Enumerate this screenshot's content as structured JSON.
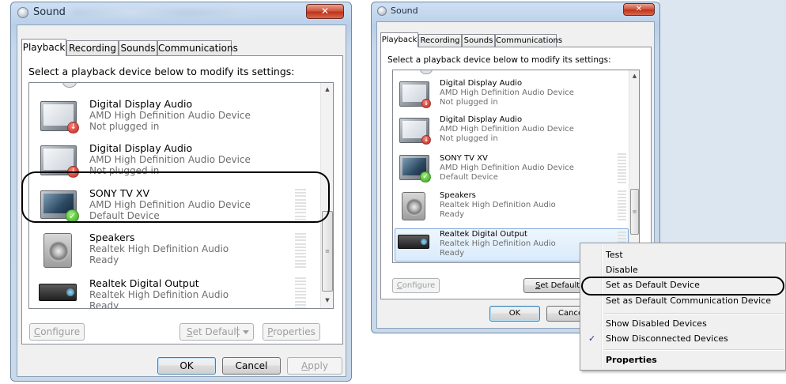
{
  "window_title": "Sound",
  "tabs": [
    "Playback",
    "Recording",
    "Sounds",
    "Communications"
  ],
  "instruction": "Select a playback device below to modify its settings:",
  "left_devices": [
    {
      "name": "Digital Display Audio",
      "line1": "AMD High Definition Audio Device",
      "line2": "Not plugged in",
      "icon": "monitor-icon",
      "status": "not-plugged-in"
    },
    {
      "name": "Digital Display Audio",
      "line1": "AMD High Definition Audio Device",
      "line2": "Not plugged in",
      "icon": "monitor-icon",
      "status": "not-plugged-in"
    },
    {
      "name": "SONY TV XV",
      "line1": "AMD High Definition Audio Device",
      "line2": "Default Device",
      "icon": "tv-icon",
      "status": "default"
    },
    {
      "name": "Speakers",
      "line1": "Realtek High Definition Audio",
      "line2": "Ready",
      "icon": "speaker-icon",
      "status": "ready"
    },
    {
      "name": "Realtek Digital Output",
      "line1": "Realtek High Definition Audio",
      "line2": "Ready",
      "icon": "receiver-icon",
      "status": "ready"
    }
  ],
  "right_devices": [
    {
      "name": "Digital Display Audio",
      "line1": "AMD High Definition Audio Device",
      "line2": "Not plugged in",
      "icon": "monitor-icon",
      "status": "not-plugged-in"
    },
    {
      "name": "Digital Display Audio",
      "line1": "AMD High Definition Audio Device",
      "line2": "Not plugged in",
      "icon": "monitor-icon",
      "status": "not-plugged-in"
    },
    {
      "name": "SONY TV XV",
      "line1": "AMD High Definition Audio Device",
      "line2": "Default Device",
      "icon": "tv-icon",
      "status": "default"
    },
    {
      "name": "Speakers",
      "line1": "Realtek High Definition Audio",
      "line2": "Ready",
      "icon": "speaker-icon",
      "status": "ready"
    },
    {
      "name": "Realtek Digital Output",
      "line1": "Realtek High Definition Audio",
      "line2": "Ready",
      "icon": "receiver-icon",
      "status": "ready",
      "selected": true
    }
  ],
  "buttons": {
    "configure_access": "C",
    "configure_rest": "onfigure",
    "set_default_access": "S",
    "set_default_rest": "et Default",
    "properties_access": "P",
    "properties_rest": "roperties",
    "ok": "OK",
    "cancel": "Cancel",
    "apply_access": "A",
    "apply_rest": "pply"
  },
  "context_menu": [
    {
      "label": "Test"
    },
    {
      "label": "Disable"
    },
    {
      "label": "Set as Default Device",
      "highlighted": true
    },
    {
      "label": "Set as Default Communication Device"
    },
    {
      "separator": true
    },
    {
      "label": "Show Disabled Devices"
    },
    {
      "label": "Show Disconnected Devices",
      "checked": true
    },
    {
      "separator": true
    },
    {
      "label": "Properties",
      "bold": true
    }
  ],
  "icons": {
    "check": "✓",
    "close": "✕",
    "badge_unplugged": "↓",
    "badge_default": "✓",
    "scroll_up": "▲",
    "scroll_down": "▼",
    "thumb_grip": "≡"
  },
  "colors": {
    "close_button": "#c0321a",
    "selection_highlight": "#d9ebfb",
    "default_badge": "#2e9f19",
    "unplugged_badge": "#c3241a",
    "annotation": "#000000"
  }
}
